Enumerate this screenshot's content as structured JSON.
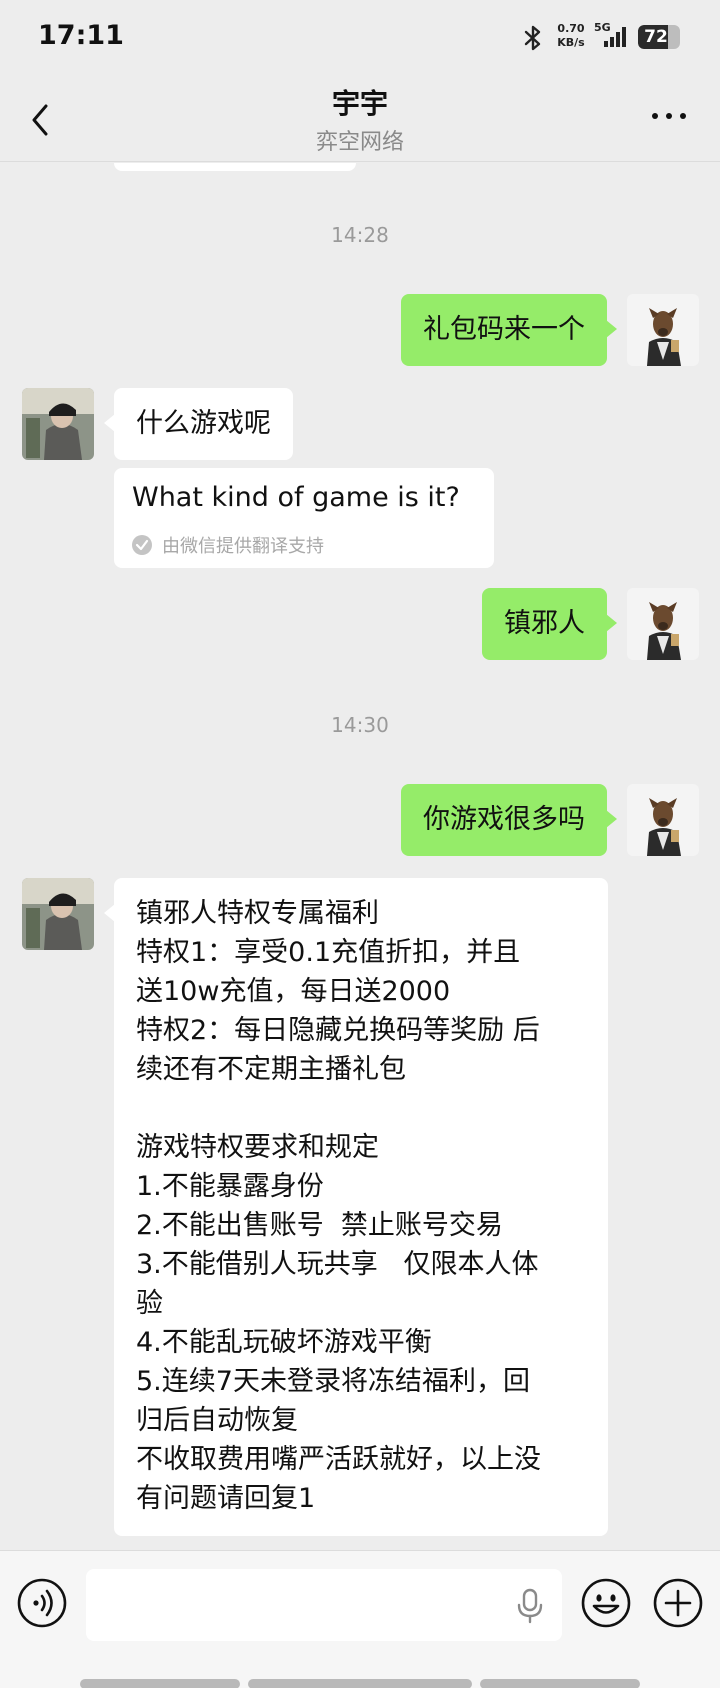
{
  "status_bar": {
    "time": "17:11",
    "net_speed_value": "0.70",
    "net_speed_unit": "KB/s",
    "network_type": "5G",
    "battery_level": "72",
    "battery_fraction": 0.72
  },
  "header": {
    "title": "宇宇",
    "subtitle": "弈空网络"
  },
  "messages": {
    "timestamp_1": "14:28",
    "msg_1": "礼包码来一个",
    "msg_2": "什么游戏呢",
    "msg_2_translation": "What kind of game is it?",
    "msg_2_translation_source": "由微信提供翻译支持",
    "msg_3": "镇邪人",
    "timestamp_2": "14:30",
    "msg_4": "你游戏很多吗",
    "msg_5": "镇邪人特权专属福利\n特权1：享受0.1充值折扣，并且\n送10w充值，每日送2000\n特权2：每日隐藏兑换码等奖励 后\n续还有不定期主播礼包\n\n游戏特权要求和规定\n1.不能暴露身份\n2.不能出售账号  禁止账号交易\n3.不能借别人玩共享   仅限本人体\n验\n4.不能乱玩破坏游戏平衡\n5.连续7天未登录将冻结福利，回\n归后自动恢复\n不收取费用嘴严活跃就好，以上没\n有问题请回复1"
  },
  "input_bar": {
    "input_value": "",
    "icons": [
      "voice-icon",
      "mic-icon",
      "emoji-icon",
      "plus-icon"
    ]
  },
  "colors": {
    "background": "#ededed",
    "self_bubble": "#95ec69",
    "other_bubble": "#ffffff"
  }
}
